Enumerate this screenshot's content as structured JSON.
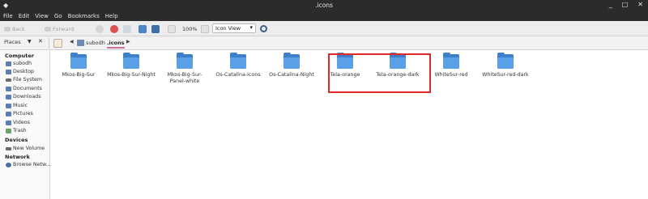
{
  "window": {
    "menu_glyph": "◆",
    "title": ".icons",
    "controls": [
      "_",
      "□",
      "✕"
    ]
  },
  "menubar": [
    "File",
    "Edit",
    "View",
    "Go",
    "Bookmarks",
    "Help"
  ],
  "toolbar": {
    "back": "Back",
    "forward": "Forward",
    "zoom": "100%",
    "view_mode": "Icon View"
  },
  "location": {
    "places": "Places",
    "crumbs": [
      "subodh",
      ".icons"
    ]
  },
  "sidebar": {
    "computer_header": "Computer",
    "computer_items": [
      "subodh",
      "Desktop",
      "File System",
      "Documents",
      "Downloads",
      "Music",
      "Pictures",
      "Videos",
      "Trash"
    ],
    "devices_header": "Devices",
    "devices_items": [
      "New Volume"
    ],
    "network_header": "Network",
    "network_items": [
      "Browse Netw..."
    ]
  },
  "files": [
    {
      "name": "Mkos-Big-Sur"
    },
    {
      "name": "Mkos-Big-Sur-Night"
    },
    {
      "name": "Mkos-Big-Sur-Panel-white"
    },
    {
      "name": "Os-Catalina-icons"
    },
    {
      "name": "Os-Catalina-Night"
    },
    {
      "name": "Tela-orange"
    },
    {
      "name": "Tela-orange-dark"
    },
    {
      "name": "WhiteSur-red"
    },
    {
      "name": "WhiteSur-red-dark"
    }
  ],
  "colors": {
    "highlight": "#e0282a",
    "folder": "#5aa0e6"
  }
}
